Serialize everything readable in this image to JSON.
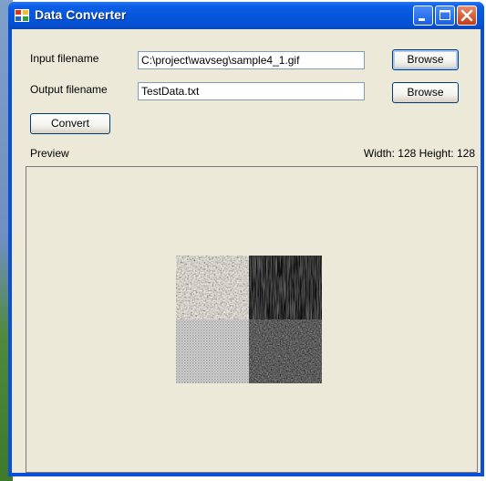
{
  "window": {
    "title": "Data Converter",
    "buttons": {
      "minimize": "minimize-icon",
      "maximize": "maximize-icon",
      "close": "close-icon"
    }
  },
  "form": {
    "input_label": "Input filename",
    "input_value": "C:\\project\\wavseg\\sample4_1.gif",
    "output_label": "Output filename",
    "output_value": "TestData.txt",
    "browse_label": "Browse",
    "convert_label": "Convert"
  },
  "preview": {
    "label": "Preview",
    "dimensions": "Width: 128  Height: 128"
  },
  "colors": {
    "titlebar": "#0556dc",
    "client_bg": "#ece9d8",
    "close_button": "#c93a14",
    "textbox_border": "#7f9db9"
  }
}
